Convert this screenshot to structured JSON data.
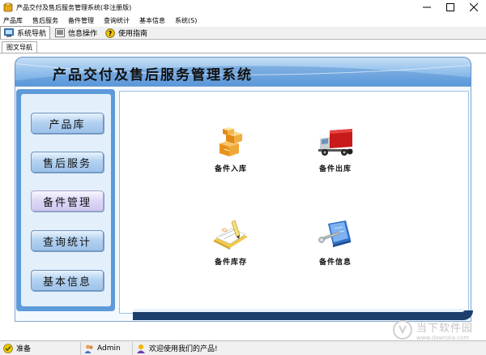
{
  "window": {
    "title": "产品交付及售后服务管理系统(非注册版)",
    "controls": [
      "minimize",
      "maximize",
      "close"
    ]
  },
  "menubar": {
    "items": [
      {
        "label": "产品库"
      },
      {
        "label": "售后服务"
      },
      {
        "label": "备件管理"
      },
      {
        "label": "查询统计"
      },
      {
        "label": "基本信息"
      },
      {
        "label": "系统(S)"
      }
    ]
  },
  "tabs": [
    {
      "label": "系统导航",
      "icon": "navigation-icon",
      "active": true
    },
    {
      "label": "信息操作",
      "icon": "info-icon",
      "active": false
    },
    {
      "label": "使用指南",
      "icon": "help-icon",
      "active": false
    }
  ],
  "subtab": {
    "label": "图文导航"
  },
  "banner": {
    "title": "产品交付及售后服务管理系统"
  },
  "nav_buttons": [
    {
      "label": "产品库",
      "selected": false
    },
    {
      "label": "售后服务",
      "selected": false
    },
    {
      "label": "备件管理",
      "selected": true
    },
    {
      "label": "查询统计",
      "selected": false
    },
    {
      "label": "基本信息",
      "selected": false
    }
  ],
  "modules": [
    {
      "label": "备件入库",
      "icon": "boxes-icon"
    },
    {
      "label": "备件出库",
      "icon": "truck-icon"
    },
    {
      "label": "备件库存",
      "icon": "notebook-icon"
    },
    {
      "label": "备件信息",
      "icon": "wrench-book-icon"
    }
  ],
  "statusbar": {
    "status": "准备",
    "user": "Admin",
    "message": "欢迎使用我们的产品!"
  },
  "watermark": {
    "text": "当下软件园",
    "url": "www.downxia.com"
  },
  "colors": {
    "banner_blue": "#6aa6e2",
    "panel_blue": "#5d9ad9",
    "nav_button": "#b4d2f1",
    "nav_selected": "#dcd6f6",
    "bottom_bar": "#1d3f6e"
  }
}
